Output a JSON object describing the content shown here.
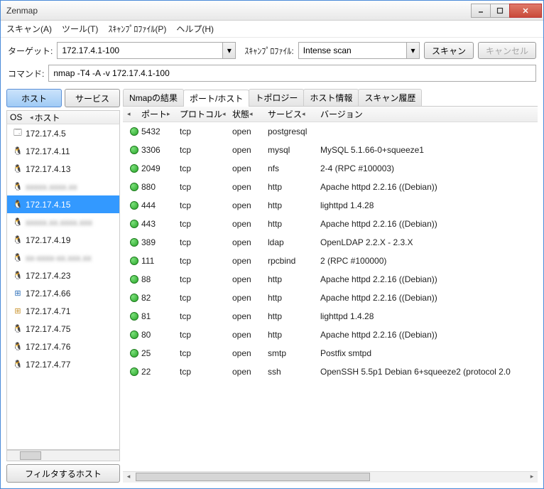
{
  "window": {
    "title": "Zenmap"
  },
  "menubar": {
    "scan": "スキャン(A)",
    "tools": "ツール(T)",
    "profile": "ｽｷｬﾝﾌﾟﾛﾌｧｲﾙ(P)",
    "help": "ヘルプ(H)"
  },
  "toolbar": {
    "target_label": "ターゲット:",
    "target_value": "172.17.4.1-100",
    "profile_label": "ｽｷｬﾝﾌﾟﾛﾌｧｲﾙ:",
    "profile_value": "Intense scan",
    "scan_btn": "スキャン",
    "cancel_btn": "キャンセル"
  },
  "command": {
    "label": "コマンド:",
    "value": "nmap -T4 -A -v 172.17.4.1-100"
  },
  "left": {
    "tab_hosts": "ホスト",
    "tab_services": "サービス",
    "col_os": "OS",
    "col_host": "ホスト",
    "filter_btn": "フィルタするホスト",
    "hosts": [
      {
        "icon": "win",
        "name": "172.17.4.5",
        "blur": false
      },
      {
        "icon": "linux",
        "name": "172.17.4.11",
        "blur": false
      },
      {
        "icon": "linux",
        "name": "172.17.4.13",
        "blur": false
      },
      {
        "icon": "linux",
        "name": "xxxxx.xxxx.xx",
        "blur": true
      },
      {
        "icon": "linux",
        "name": "172.17.4.15",
        "blur": false,
        "selected": true
      },
      {
        "icon": "linux",
        "name": "xxxxx.xx.xxxx.xxx",
        "blur": true
      },
      {
        "icon": "linux",
        "name": "172.17.4.19",
        "blur": false
      },
      {
        "icon": "linux",
        "name": "xx-xxxx-xx.xxx.xx",
        "blur": true
      },
      {
        "icon": "linux",
        "name": "172.17.4.23",
        "blur": false
      },
      {
        "icon": "win2",
        "name": "172.17.4.66",
        "blur": false
      },
      {
        "icon": "win3",
        "name": "172.17.4.71",
        "blur": false
      },
      {
        "icon": "linux",
        "name": "172.17.4.75",
        "blur": false
      },
      {
        "icon": "linux",
        "name": "172.17.4.76",
        "blur": false
      },
      {
        "icon": "linux",
        "name": "172.17.4.77",
        "blur": false
      }
    ]
  },
  "right": {
    "tabs": {
      "nmap_output": "Nmapの結果",
      "ports_hosts": "ポート/ホスト",
      "topology": "トポロジー",
      "host_details": "ホスト情報",
      "scans": "スキャン履歴"
    },
    "headers": {
      "port": "ポート",
      "protocol": "プロトコル",
      "state": "状態",
      "service": "サービス",
      "version": "バージョン"
    },
    "ports": [
      {
        "port": "5432",
        "proto": "tcp",
        "state": "open",
        "service": "postgresql",
        "version": ""
      },
      {
        "port": "3306",
        "proto": "tcp",
        "state": "open",
        "service": "mysql",
        "version": "MySQL 5.1.66-0+squeeze1"
      },
      {
        "port": "2049",
        "proto": "tcp",
        "state": "open",
        "service": "nfs",
        "version": "2-4 (RPC #100003)"
      },
      {
        "port": "880",
        "proto": "tcp",
        "state": "open",
        "service": "http",
        "version": "Apache httpd 2.2.16 ((Debian))"
      },
      {
        "port": "444",
        "proto": "tcp",
        "state": "open",
        "service": "http",
        "version": "lighttpd 1.4.28"
      },
      {
        "port": "443",
        "proto": "tcp",
        "state": "open",
        "service": "http",
        "version": "Apache httpd 2.2.16 ((Debian))"
      },
      {
        "port": "389",
        "proto": "tcp",
        "state": "open",
        "service": "ldap",
        "version": "OpenLDAP 2.2.X - 2.3.X"
      },
      {
        "port": "111",
        "proto": "tcp",
        "state": "open",
        "service": "rpcbind",
        "version": "2 (RPC #100000)"
      },
      {
        "port": "88",
        "proto": "tcp",
        "state": "open",
        "service": "http",
        "version": "Apache httpd 2.2.16 ((Debian))"
      },
      {
        "port": "82",
        "proto": "tcp",
        "state": "open",
        "service": "http",
        "version": "Apache httpd 2.2.16 ((Debian))"
      },
      {
        "port": "81",
        "proto": "tcp",
        "state": "open",
        "service": "http",
        "version": "lighttpd 1.4.28"
      },
      {
        "port": "80",
        "proto": "tcp",
        "state": "open",
        "service": "http",
        "version": "Apache httpd 2.2.16 ((Debian))"
      },
      {
        "port": "25",
        "proto": "tcp",
        "state": "open",
        "service": "smtp",
        "version": "Postfix smtpd"
      },
      {
        "port": "22",
        "proto": "tcp",
        "state": "open",
        "service": "ssh",
        "version": "OpenSSH 5.5p1 Debian 6+squeeze2 (protocol 2.0"
      }
    ]
  }
}
